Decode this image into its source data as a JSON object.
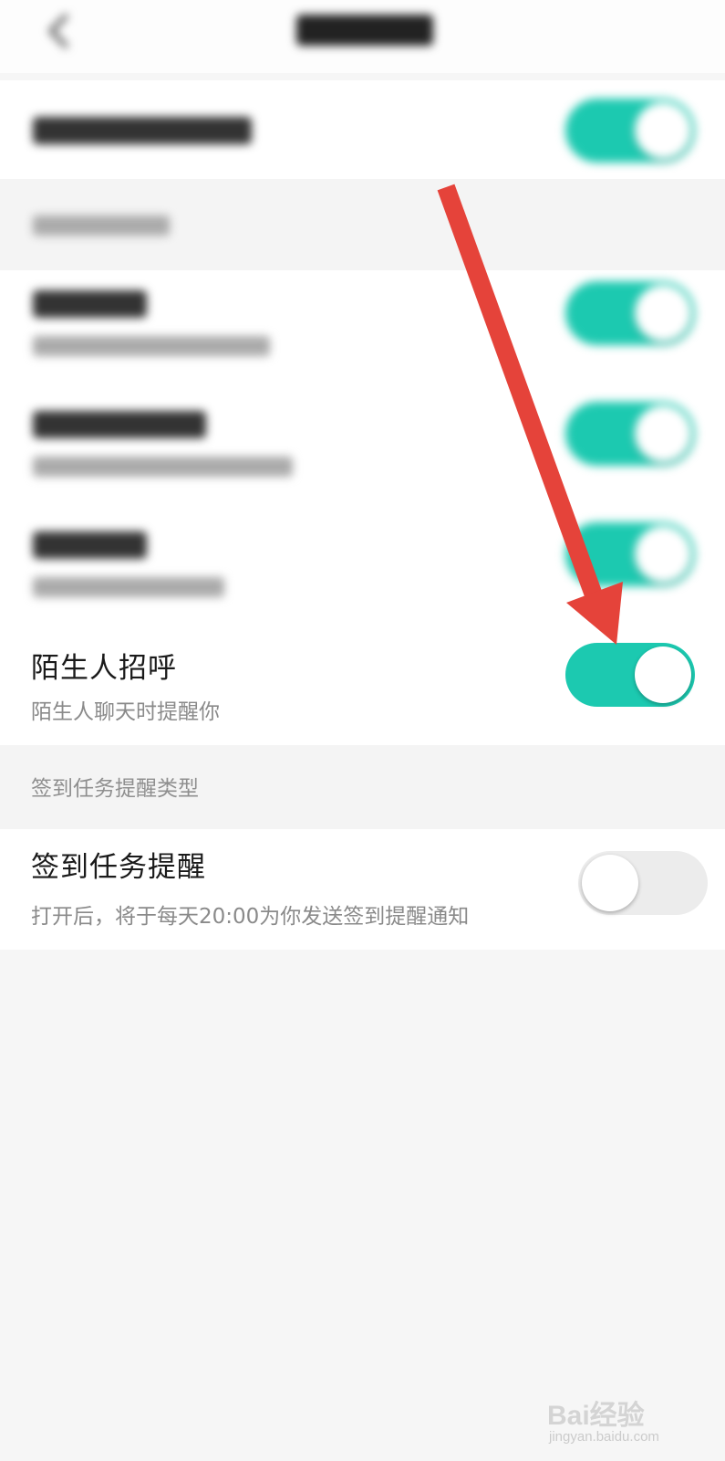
{
  "stranger_greeting": {
    "title": "陌生人招呼",
    "subtitle": "陌生人聊天时提醒你",
    "enabled": true
  },
  "checkin_section": {
    "label": "签到任务提醒类型"
  },
  "checkin_reminder": {
    "title": "签到任务提醒",
    "subtitle": "打开后，将于每天20:00为你发送签到提醒通知",
    "enabled": false
  },
  "blurred_toggles_enabled": [
    true,
    true,
    true,
    true
  ],
  "colors": {
    "toggle_on": "#1cc9b0",
    "toggle_off": "#ececec",
    "arrow": "#e5433a",
    "background": "#f6f6f6"
  },
  "watermark": {
    "brand": "Bai经验",
    "url": "jingyan.baidu.com"
  }
}
